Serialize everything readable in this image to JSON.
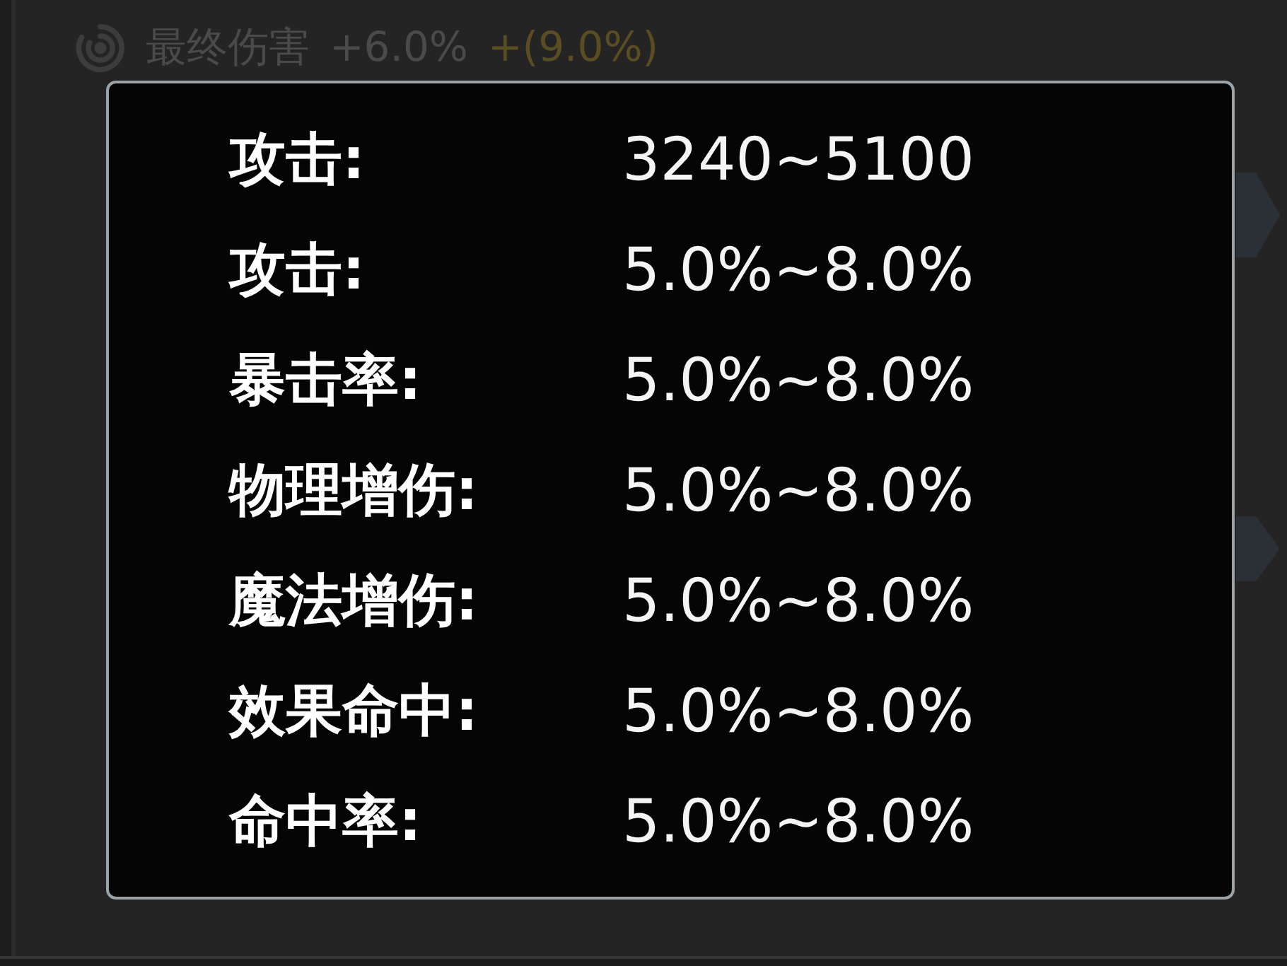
{
  "background": {
    "stat_line": {
      "label": "最终伤害",
      "value": "+6.0%",
      "bonus": "+(9.0%)"
    },
    "side_tabs": [
      {
        "kind": "tall"
      },
      {
        "kind": "short"
      }
    ]
  },
  "tooltip": {
    "rows": [
      {
        "label": "攻击:",
        "value": "3240~5100"
      },
      {
        "label": "攻击:",
        "value": "5.0%~8.0%"
      },
      {
        "label": "暴击率:",
        "value": "5.0%~8.0%"
      },
      {
        "label": "物理增伤:",
        "value": "5.0%~8.0%"
      },
      {
        "label": "魔法增伤:",
        "value": "5.0%~8.0%"
      },
      {
        "label": "效果命中:",
        "value": "5.0%~8.0%"
      },
      {
        "label": "命中率:",
        "value": "5.0%~8.0%"
      }
    ]
  }
}
